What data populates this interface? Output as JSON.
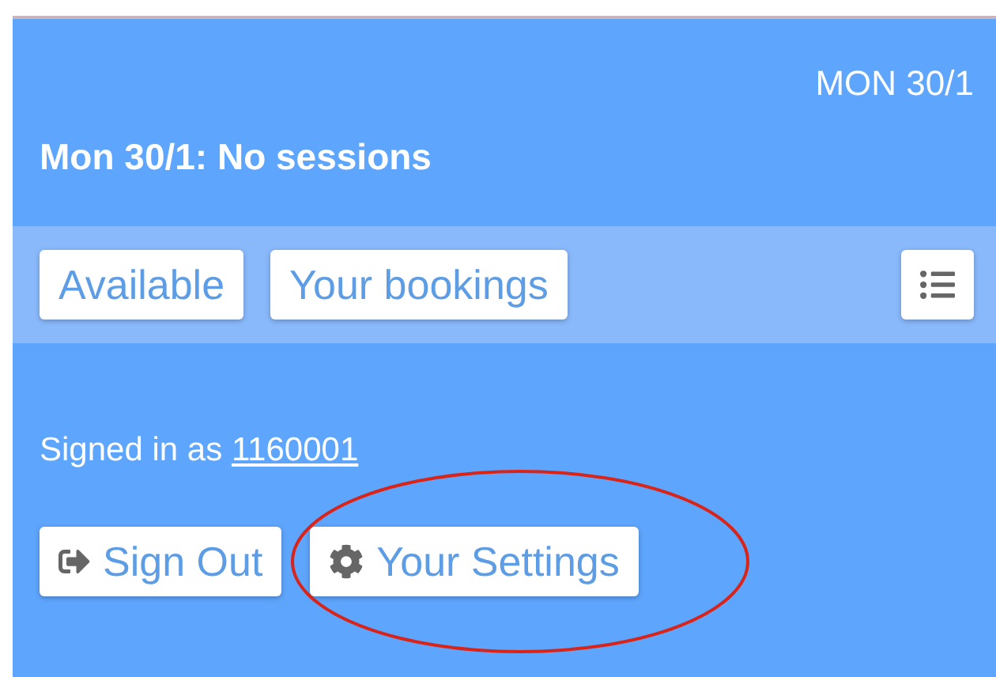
{
  "header": {
    "date": "MON 30/1",
    "title": "Mon 30/1: No sessions"
  },
  "toolbar": {
    "tabs": [
      {
        "label": "Available",
        "selected": false
      },
      {
        "label": "Your bookings",
        "selected": false
      }
    ]
  },
  "account": {
    "signed_in_text": "Signed in as",
    "user_id": "1160001"
  },
  "actions": [
    {
      "kind": "signout",
      "label": "Sign Out",
      "highlighted": false
    },
    {
      "kind": "settings",
      "label": "Your Settings",
      "highlighted": true
    }
  ]
}
